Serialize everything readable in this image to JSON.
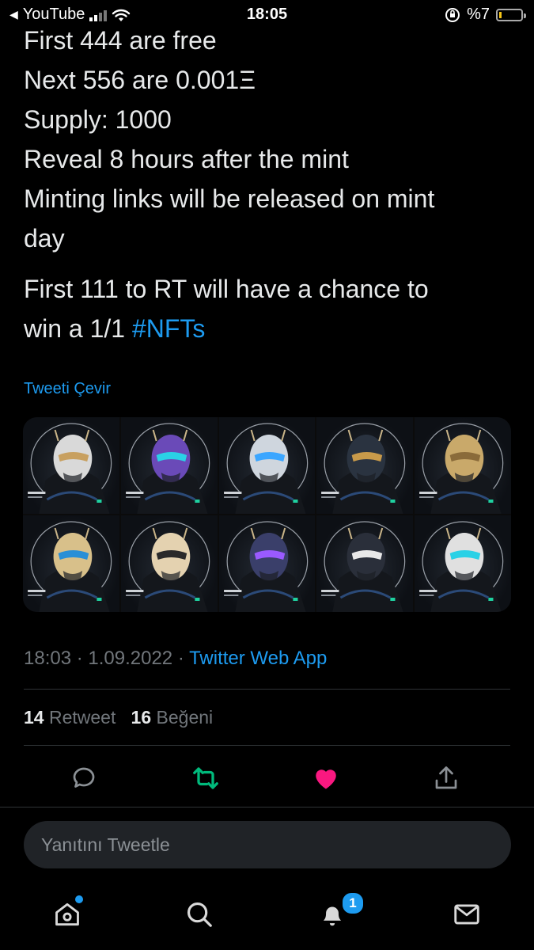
{
  "status_bar": {
    "back_app": "YouTube",
    "time": "18:05",
    "battery": "%7"
  },
  "tweet": {
    "lines": [
      "First 444 are free",
      "Next 556 are 0.001Ξ",
      "Supply: 1000",
      "Reveal 8 hours after the mint",
      "Minting links will be released on mint",
      "day"
    ],
    "para2_text": "First 111 to RT will have a chance to",
    "para2_line2": "win a 1/1 ",
    "hashtag": "#NFTs",
    "translate_label": "Tweeti Çevir"
  },
  "media": {
    "masks": [
      {
        "mask": "#d9d9d9",
        "accent": "#c8a060"
      },
      {
        "mask": "#6a4ab8",
        "accent": "#2ad1e6"
      },
      {
        "mask": "#cfd6de",
        "accent": "#3ba6ff"
      },
      {
        "mask": "#2a3340",
        "accent": "#c89a4a"
      },
      {
        "mask": "#c9a96a",
        "accent": "#8a6b3a"
      },
      {
        "mask": "#d8c08a",
        "accent": "#2a8fd6"
      },
      {
        "mask": "#e4d2b0",
        "accent": "#2a2a2a"
      },
      {
        "mask": "#3a3f6a",
        "accent": "#9a5aff"
      },
      {
        "mask": "#2a2f3a",
        "accent": "#e8e8e8"
      },
      {
        "mask": "#e0e0e0",
        "accent": "#2ad1e6"
      }
    ]
  },
  "meta": {
    "time_date": "18:03 · 1.09.2022 · ",
    "app": "Twitter Web App"
  },
  "stats": {
    "retweet_count": "14",
    "retweet_label": "Retweet",
    "like_count": "16",
    "like_label": "Beğeni"
  },
  "actions": {
    "reply_color": "#8b9095",
    "retweet_color": "#00ba7c",
    "like_color": "#f91880",
    "share_color": "#8b9095"
  },
  "reply_placeholder": "Yanıtını Tweetle",
  "tabbar": {
    "notifications_badge": "1"
  }
}
